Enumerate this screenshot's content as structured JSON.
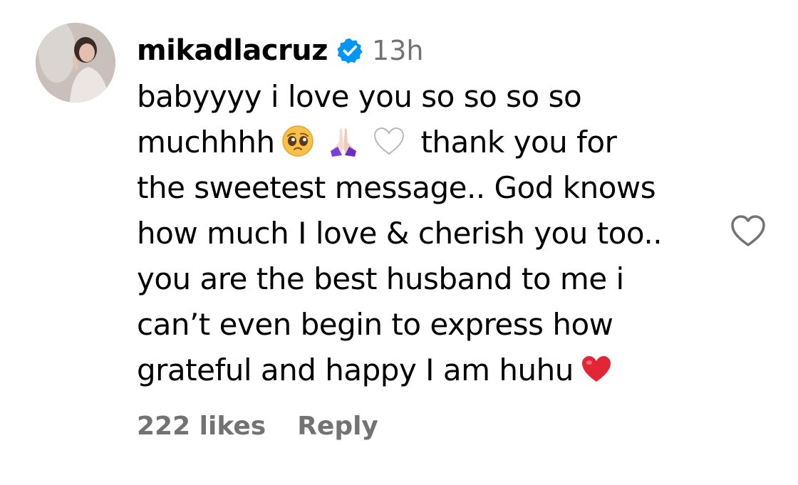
{
  "comment": {
    "avatar_icon": "avatar-photo",
    "username": "mikadlacruz",
    "verified_icon": "verified-badge-icon",
    "verified_color": "#0095f6",
    "time": "13h",
    "text_lines": [
      "babyyyy i love you so so so so",
      "muchhhh",
      "thank you for",
      "the sweetest message.. God knows",
      "how much I love & cherish you too..",
      "you are the best husband to me i",
      "can’t even begin to express how",
      "grateful and happy I am huhu"
    ],
    "emojis": [
      "pleading-face-emoji",
      "folded-hands-emoji",
      "white-heart-emoji",
      "red-heart-emoji"
    ],
    "likes": "222 likes",
    "reply_label": "Reply",
    "like_icon": "heart-outline-icon"
  }
}
